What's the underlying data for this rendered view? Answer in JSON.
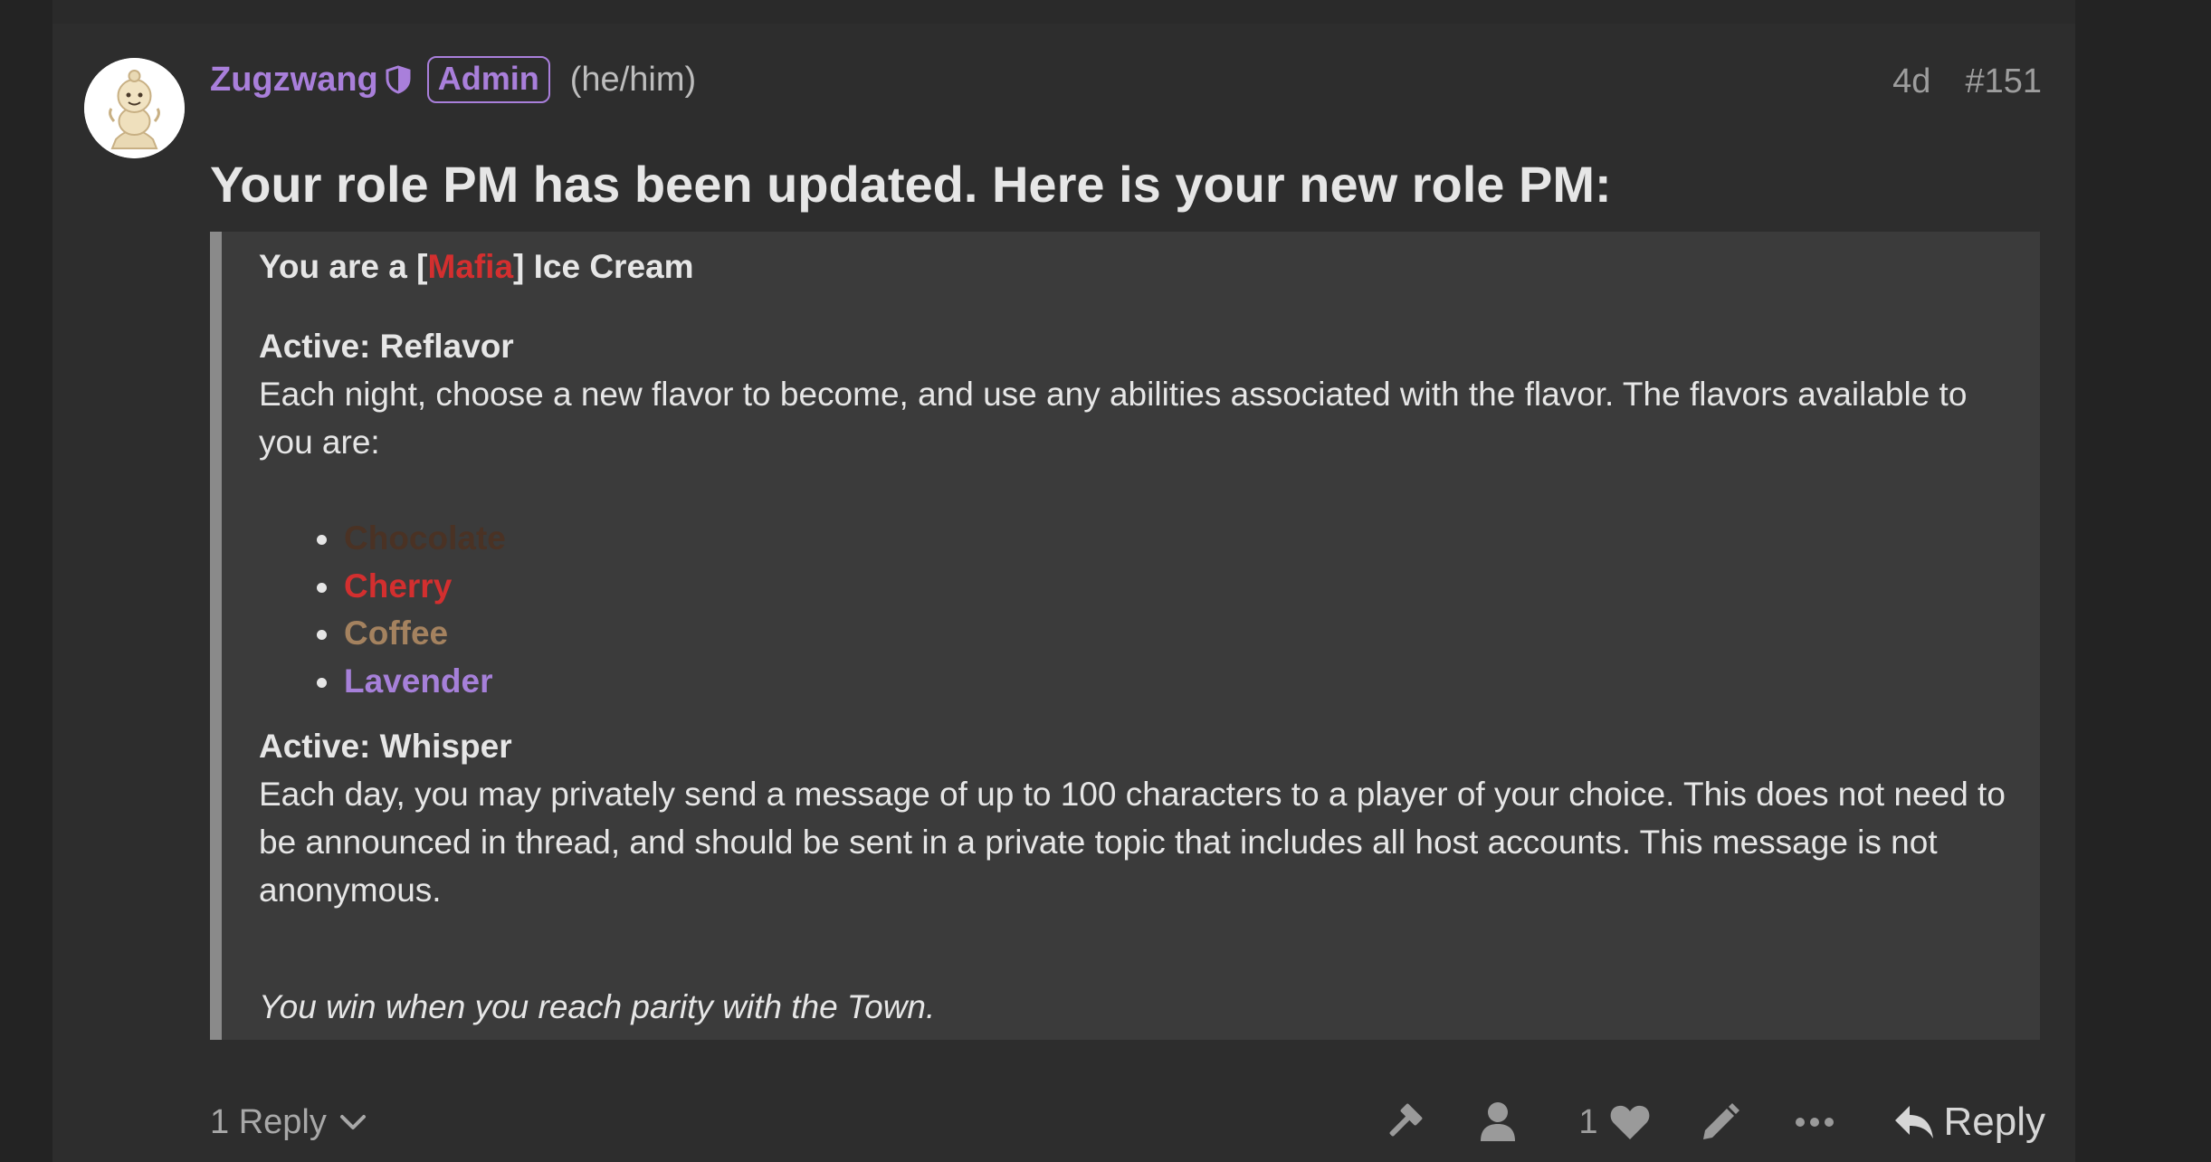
{
  "post": {
    "username": "Zugzwang",
    "badge": "Admin",
    "pronouns": "(he/him)",
    "age": "4d",
    "post_number": "#151",
    "headline": "Your role PM has been updated. Here is your new role PM:"
  },
  "role": {
    "intro_prefix": "You are a [",
    "alignment": "Mafia",
    "intro_suffix": "] Ice Cream",
    "ability1_title": "Active: Reflavor",
    "ability1_desc": "Each night, choose a new flavor to become, and use any abilities associated with the flavor. The flavors available to you are:",
    "flavors": [
      {
        "name": "Chocolate",
        "color": "#4a3224"
      },
      {
        "name": "Cherry",
        "color": "#d32f2f"
      },
      {
        "name": "Coffee",
        "color": "#a4825f"
      },
      {
        "name": "Lavender",
        "color": "#a680d9"
      }
    ],
    "ability2_title": "Active: Whisper",
    "ability2_desc": "Each day, you may privately send a message of up to 100 characters to a player of your choice. This does not need to be announced in thread, and should be sent in a private topic that includes all host accounts. This message is not anonymous.",
    "win_condition": "You win when you reach parity with the Town."
  },
  "footer": {
    "replies_label": "1 Reply",
    "like_count": "1",
    "reply_label": "Reply"
  },
  "icons": {
    "shield": "shield-icon",
    "chevron": "chevron-down-icon",
    "hammer": "hammer-icon",
    "user": "user-icon",
    "heart": "heart-icon",
    "pencil": "pencil-icon",
    "more": "ellipsis-icon",
    "reply": "reply-arrow-icon"
  },
  "colors": {
    "username": "#a97fdb",
    "mafia": "#d32f2f",
    "background": "#2d2d2d",
    "quote_bg": "#3b3b3b"
  }
}
